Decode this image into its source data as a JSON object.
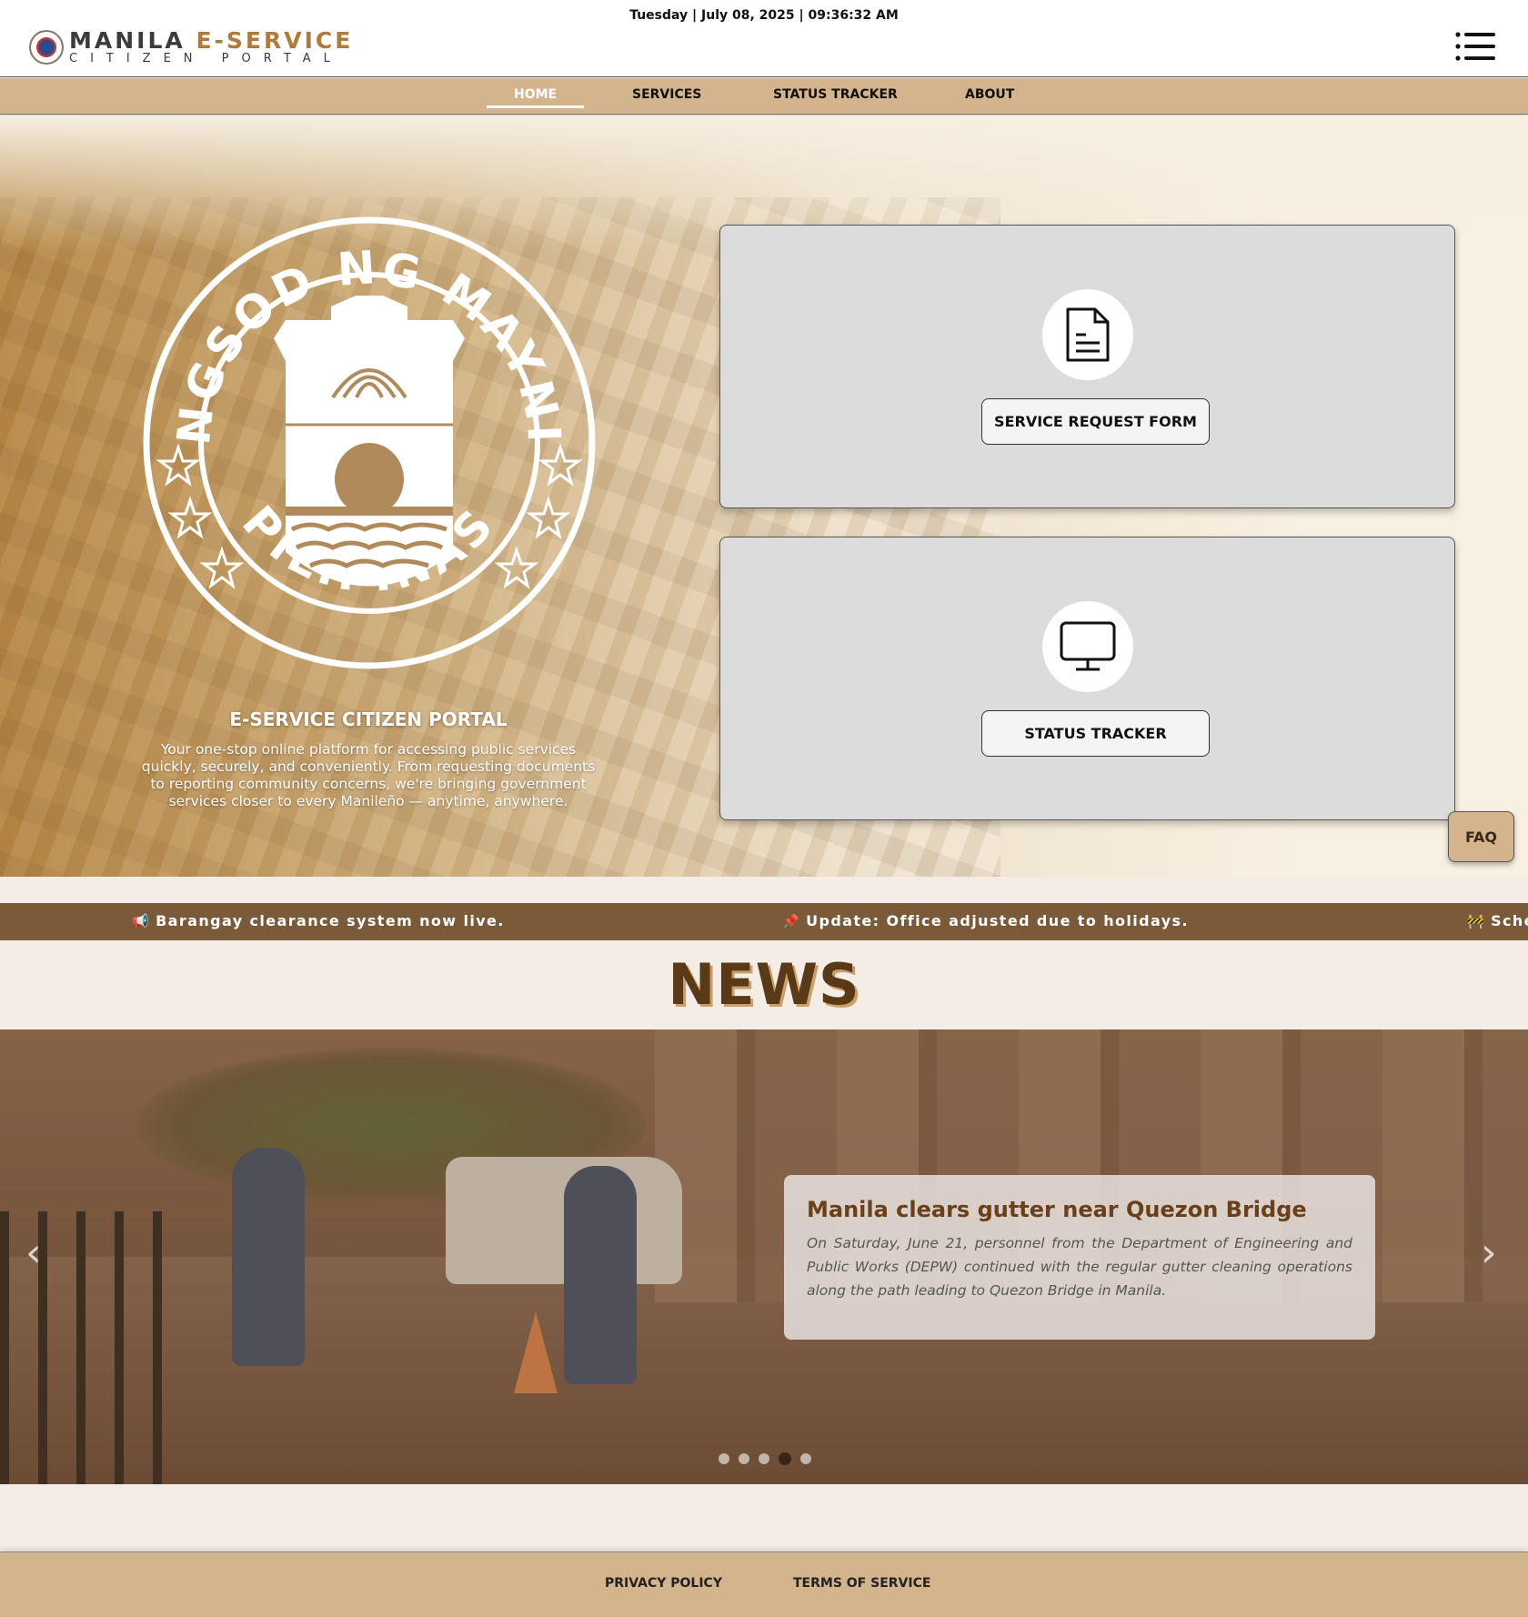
{
  "header": {
    "datetime": "Tuesday | July 08, 2025 | 09:36:32 AM",
    "logo_main_1": "MANILA",
    "logo_main_2": "E-SERVICE",
    "logo_sub": "CITIZEN PORTAL",
    "menu_icon": "list-menu-icon"
  },
  "nav": {
    "items": [
      {
        "label": "HOME",
        "active": true
      },
      {
        "label": "SERVICES"
      },
      {
        "label": "STATUS TRACKER"
      },
      {
        "label": "ABOUT"
      }
    ]
  },
  "hero": {
    "seal": {
      "top_text": "LUNGSOD NG MAYNILA",
      "bottom_text": "PILIPINAS"
    },
    "title": "E-SERVICE CITIZEN PORTAL",
    "description": "Your one-stop online platform for accessing public services quickly, securely, and conveniently. From requesting documents to reporting community concerns, we're bringing government services closer to every Manileño — anytime, anywhere.",
    "cards": [
      {
        "icon": "document-icon",
        "button_label": "SERVICE REQUEST FORM"
      },
      {
        "icon": "monitor-icon",
        "button_label": "STATUS TRACKER"
      }
    ],
    "faq_label": "FAQ"
  },
  "ticker": {
    "items": [
      {
        "icon": "megaphone-icon",
        "glyph": "📢",
        "text": "Barangay clearance system now live."
      },
      {
        "icon": "pin-icon",
        "glyph": "📌",
        "text": "Update: Office adjusted due to holidays."
      },
      {
        "icon": "construction-icon",
        "glyph": "🚧",
        "text": "Sche"
      }
    ]
  },
  "news": {
    "heading": "NEWS",
    "slide": {
      "title": "Manila clears gutter near Quezon Bridge",
      "text": "On Saturday, June 21, personnel from the Department of Engineering and Public Works (DEPW) continued with the regular gutter cleaning operations along the path leading to Quezon Bridge in Manila."
    },
    "prev_label": "‹",
    "next_label": "›",
    "slide_count": 5,
    "active_slide": 4
  },
  "footer": {
    "privacy_label": "PRIVACY POLICY",
    "terms_label": "TERMS OF SERVICE"
  },
  "colors": {
    "nav_bg": "#d4b48c",
    "ticker_bg": "#7b5a3a",
    "news_title": "#5a3a16",
    "accent": "#b07a3a"
  }
}
